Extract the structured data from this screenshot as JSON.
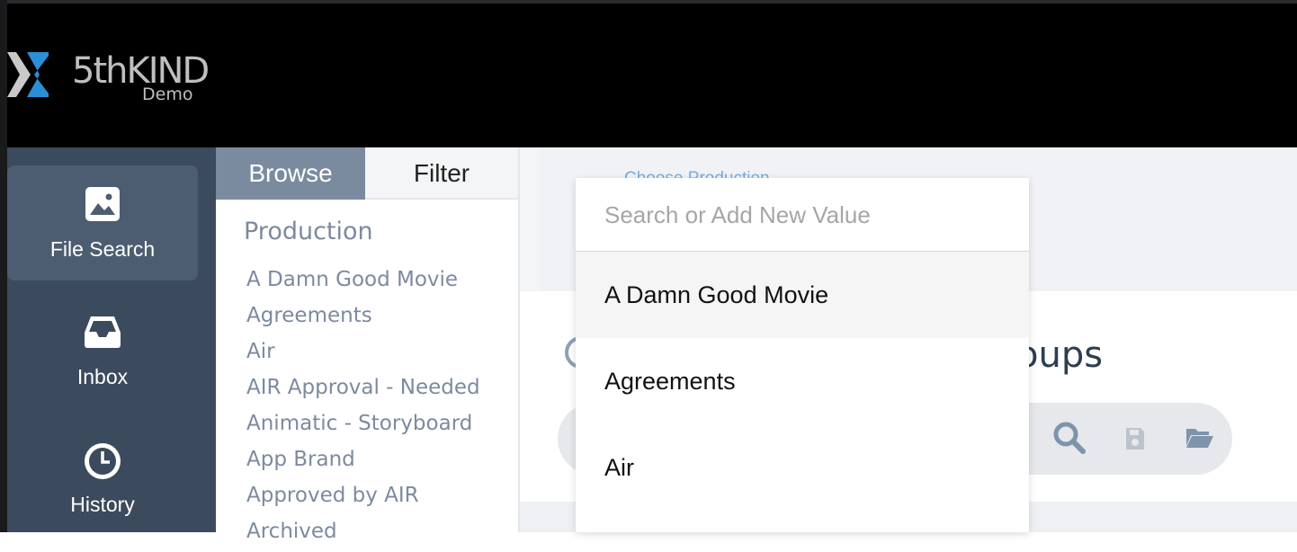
{
  "brand": {
    "name": "5thKIND",
    "sub": "Demo"
  },
  "nav": [
    {
      "label": "File Search",
      "icon": "image-icon",
      "active": true
    },
    {
      "label": "Inbox",
      "icon": "inbox-icon"
    },
    {
      "label": "History",
      "icon": "clock-icon"
    }
  ],
  "browse": {
    "tab_browse": "Browse",
    "tab_filter": "Filter",
    "section": "Production",
    "items": [
      "A Damn Good Movie",
      "Agreements",
      "Air",
      "AIR Approval - Needed",
      "Animatic - Storyboard",
      "App Brand",
      "Approved by AIR",
      "Archived"
    ]
  },
  "main": {
    "choose_production": "Choose Production",
    "close_glyph": "✕",
    "groups_title_partial": "oups"
  },
  "dropdown": {
    "placeholder": "Search or Add New Value",
    "value": "",
    "options": [
      "A Damn Good Movie",
      "Agreements",
      "Air"
    ]
  },
  "colors": {
    "nav_bg": "#3b4a5c",
    "nav_active": "#4d5d71",
    "browse_tab": "#7a8ba0",
    "link_text": "#7c8aa0",
    "choose_link": "#72aee0",
    "logo_accent": "#2b8fd8"
  }
}
